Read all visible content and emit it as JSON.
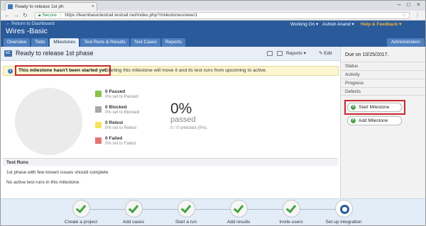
{
  "browser": {
    "tab_title": "Ready to release 1st ph",
    "secure_label": "Secure",
    "url": "https://learnbasictestrail.testrail.net/index.php?/milestones/view/1"
  },
  "header": {
    "back_link": "← Return to Dashboard",
    "project_title": "Wires -Basic",
    "working_on": "Working On ▾",
    "user": "Ashish Anand ▾",
    "help": "Help & Feedback ▾",
    "tabs": [
      {
        "label": "Overview"
      },
      {
        "label": "Todo"
      },
      {
        "label": "Milestones"
      },
      {
        "label": "Test Runs & Results"
      },
      {
        "label": "Test Cases"
      },
      {
        "label": "Reports"
      }
    ],
    "admin": "Administration"
  },
  "milestone": {
    "badge": "M1",
    "title": "Ready to release 1st phase",
    "reports_label": "Reports ▾",
    "edit_label": "Edit",
    "notice_strong": "This milestone hasn't been started yet.",
    "notice_rest": "Starting this milestone will move it and its test runs from upcoming to active.",
    "legend": [
      {
        "label": "0 Passed",
        "sub": "0% set to Passed",
        "color": "#8bc34a"
      },
      {
        "label": "0 Blocked",
        "sub": "0% set to Blocked",
        "color": "#a8a8a8"
      },
      {
        "label": "0 Retest",
        "sub": "0% set to Retest",
        "color": "#f5e35f"
      },
      {
        "label": "0 Failed",
        "sub": "0% set to Failed",
        "color": "#e57373"
      }
    ],
    "percent": "0%",
    "percent_label": "passed",
    "untested": "0 / 0 untested (0%).",
    "runs_header": "Test Runs",
    "runs_desc": "1st phase with few known issues should complete",
    "runs_empty": "No active test runs in this milestone."
  },
  "sidebar": {
    "due": "Due on 10/25/2017.",
    "items": [
      {
        "label": "Status"
      },
      {
        "label": "Activity"
      },
      {
        "label": "Progress"
      },
      {
        "label": "Defects"
      }
    ],
    "start_button": "Start Milestone",
    "add_button": "Add Milestone"
  },
  "steps": [
    {
      "label": "Create a project"
    },
    {
      "label": "Add cases"
    },
    {
      "label": "Start a run"
    },
    {
      "label": "Add results"
    },
    {
      "label": "Invite users"
    },
    {
      "label": "Set up integration"
    }
  ]
}
